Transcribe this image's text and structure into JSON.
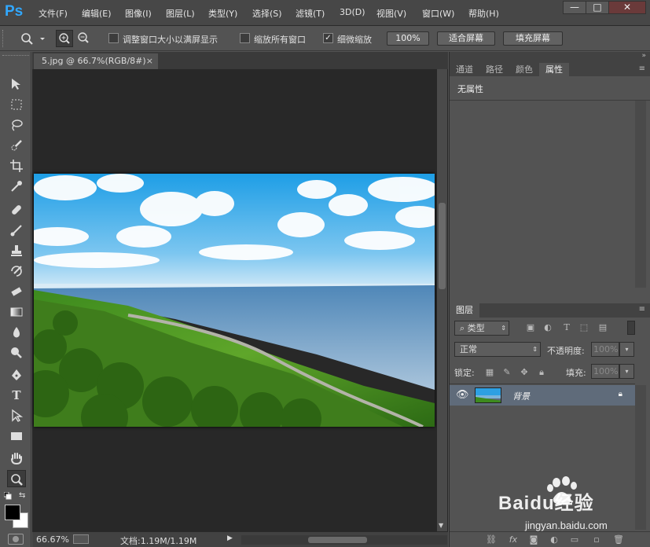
{
  "app": {
    "logo": "Ps"
  },
  "menu": [
    "文件(F)",
    "编辑(E)",
    "图像(I)",
    "图层(L)",
    "类型(Y)",
    "选择(S)",
    "滤镜(T)",
    "3D(D)",
    "视图(V)",
    "窗口(W)",
    "帮助(H)"
  ],
  "window_controls": {
    "minimize": "—",
    "maximize": "□",
    "close": "✕"
  },
  "options": {
    "resize_windows_label": "调整窗口大小以满屏显示",
    "resize_windows_checked": false,
    "zoom_all_label": "缩放所有窗口",
    "zoom_all_checked": false,
    "scrubby_label": "细微缩放",
    "scrubby_checked": true,
    "btn_100": "100%",
    "btn_fit": "适合屏幕",
    "btn_fill": "填充屏幕"
  },
  "document": {
    "tab_title": "5.jpg @ 66.7%(RGB/8#)",
    "tab_close": "×",
    "zoom": "66.67%",
    "doc_size": "文档:1.19M/1.19M"
  },
  "properties_panel": {
    "tabs": [
      "通道",
      "路径",
      "颜色",
      "属性"
    ],
    "active_tab": "属性",
    "body": "无属性"
  },
  "layers_panel": {
    "tab": "图层",
    "filter_kind": "类型",
    "blend_mode": "正常",
    "opacity_label": "不透明度:",
    "opacity_value": "100%",
    "lock_label": "锁定:",
    "fill_label": "填充:",
    "fill_value": "100%",
    "layers": [
      {
        "name": "背景",
        "visible": true,
        "locked": true
      }
    ]
  },
  "watermark": {
    "brand": "Baidu经验",
    "url": "jingyan.baidu.com"
  },
  "colors": {
    "accent": "#31a8ff",
    "selected_layer": "#5f6b7a"
  }
}
